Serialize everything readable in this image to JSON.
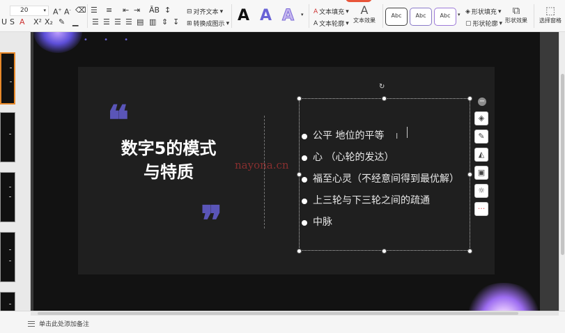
{
  "toolbar": {
    "font_size": "20",
    "align_text": "对齐文本",
    "convert_smartart": "转换成图示",
    "text_fill": "文本填充",
    "text_outline": "文本轮廓",
    "text_effects": "文本效果",
    "text_style_glyph": "A",
    "shape_styles": [
      "Abc",
      "Abc",
      "Abc"
    ],
    "shape_fill": "形状填充",
    "shape_outline": "形状轮廓",
    "shape_effects": "形状效果",
    "select_pane": "选择窗格"
  },
  "slide": {
    "title_line1": "数字5的模式",
    "title_line2": "与特质",
    "open_quote": "❝",
    "close_quote": "❞",
    "dots": "• • •",
    "bullets": [
      "公平  地位的平等",
      "心    （心轮的发达）",
      "福至心灵（不经意间得到最优解）",
      "上三轮与下三轮之间的疏通",
      "中脉"
    ],
    "watermark": "nayona.cn"
  },
  "float_tools": {
    "collapse": "−",
    "icons": [
      "layers-icon",
      "pen-icon",
      "fill-icon",
      "crop-icon",
      "bulb-icon",
      "more-icon"
    ]
  },
  "status": {
    "notes_placeholder": "单击此处添加备注"
  },
  "colors": {
    "slide_bg": "#121212",
    "panel_bg": "#1f1f1f",
    "accent_purple": "#5a55b8",
    "text_white": "#ffffff"
  }
}
